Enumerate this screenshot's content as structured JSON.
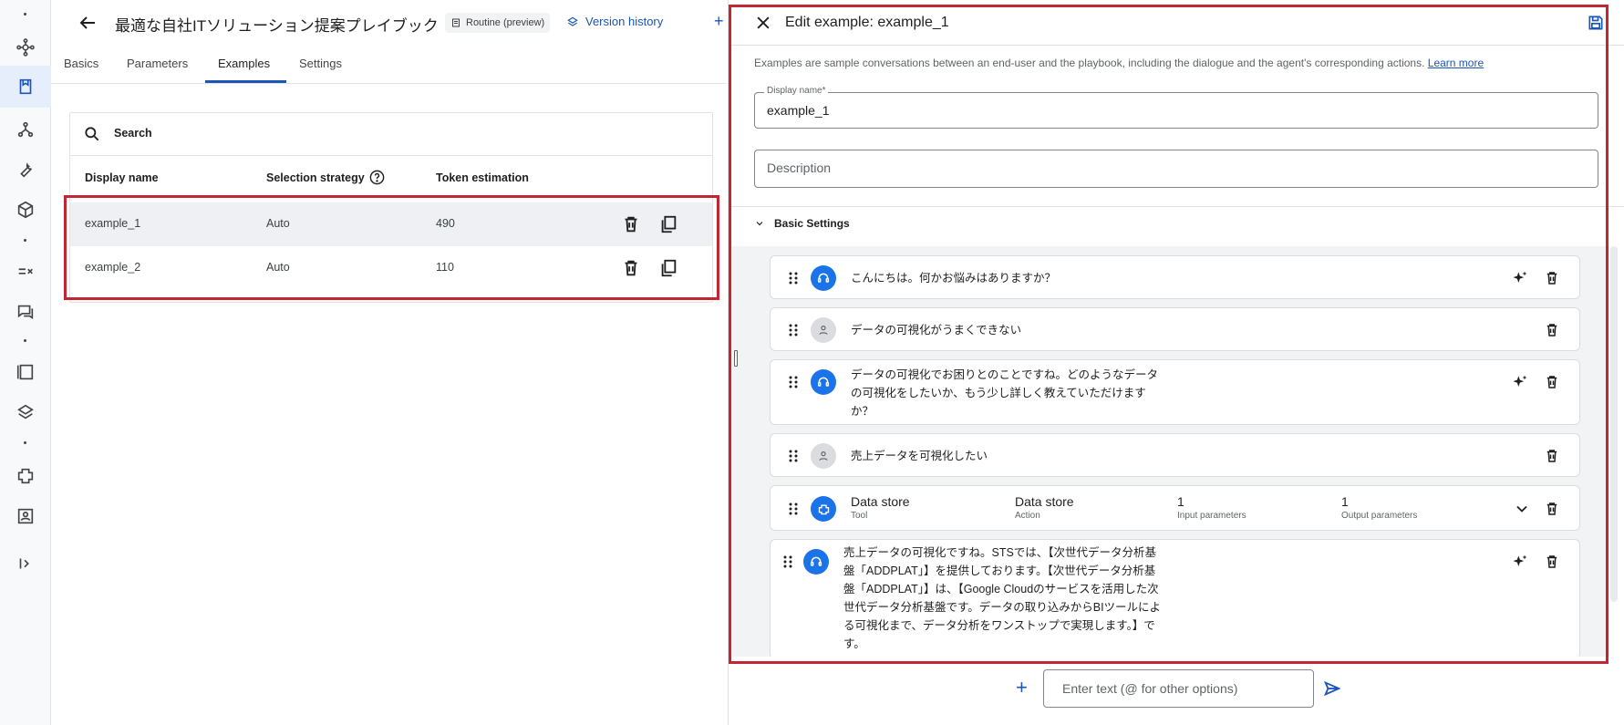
{
  "header": {
    "title": "最適な自社ITソリューション提案プレイブック",
    "chip_label": "Routine (preview)",
    "version_history_label": "Version history",
    "plus_label": "+"
  },
  "tabs": [
    {
      "label": "Basics"
    },
    {
      "label": "Parameters"
    },
    {
      "label": "Examples"
    },
    {
      "label": "Settings"
    }
  ],
  "search": {
    "label": "Search"
  },
  "table": {
    "columns": [
      "Display name",
      "Selection strategy",
      "Token estimation"
    ],
    "rows": [
      {
        "name": "example_1",
        "strategy": "Auto",
        "tokens": "490"
      },
      {
        "name": "example_2",
        "strategy": "Auto",
        "tokens": "110"
      }
    ]
  },
  "panel": {
    "title": "Edit example: example_1",
    "description": "Examples are sample conversations between an end-user and the playbook, including the dialogue and the agent's corresponding actions.",
    "learn_more": "Learn more",
    "display_name_label": "Display name*",
    "display_name_value": "example_1",
    "description_placeholder": "Description",
    "section_label": "Basic Settings",
    "turns": [
      {
        "role": "agent",
        "text": "こんにちは。何かお悩みはありますか？"
      },
      {
        "role": "user",
        "text": "データの可視化がうまくできない"
      },
      {
        "role": "agent",
        "lines": [
          "データの可視化でお困りとのことですね。どのようなデータ",
          "の可視化をしたいか、もう少し詳しく教えていただけます",
          "か？"
        ]
      },
      {
        "role": "user",
        "text": "売上データを可視化したい"
      },
      {
        "role": "tool",
        "cols": [
          {
            "main": "Data store",
            "sub": "Tool"
          },
          {
            "main": "Data store",
            "sub": "Action"
          },
          {
            "main": "1",
            "sub": "Input parameters"
          },
          {
            "main": "1",
            "sub": "Output parameters"
          }
        ]
      },
      {
        "role": "agent",
        "lines": [
          "売上データの可視化ですね。STSでは、【次世代データ分析基",
          "盤「ADDPLAT」】を提供しております。【次世代データ分析基",
          "盤「ADDPLAT」】は、【Google Cloudのサービスを活用した次",
          "世代データ分析基盤です。データの取り込みからBIツールによ",
          "る可視化まで、データ分析をワンストップで実現します。】で",
          "す。"
        ]
      }
    ]
  },
  "composer": {
    "placeholder": "Enter text (@ for other options)"
  },
  "colors": {
    "accent": "#1a56b8",
    "highlight": "#c42631"
  }
}
